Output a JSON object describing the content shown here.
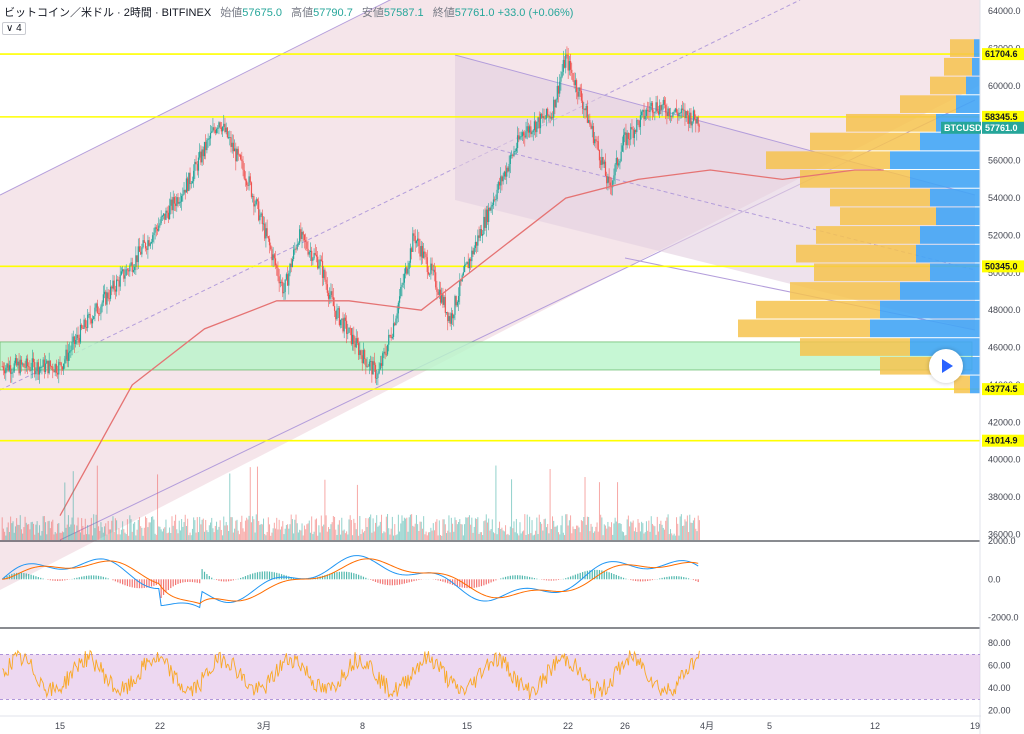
{
  "header": {
    "symbol_line": "ビットコイン／米ドル · 2時間 · BITFINEX",
    "open_label": "始値",
    "open": "57675.0",
    "high_label": "高値",
    "high": "57790.7",
    "low_label": "安値",
    "low": "57587.1",
    "close_label": "終値",
    "close": "57761.0",
    "change": "+33.0 (+0.06%)"
  },
  "indicator_toggle": "∨ 4",
  "colors": {
    "up": "#26a69a",
    "down": "#ef5350",
    "level": "#ffff00",
    "channel": "#b39ddb",
    "zone": "#b9f6ca",
    "ma": "#e57373",
    "vp_up": "#42a5f5",
    "vp_down": "#f6c34e",
    "rsi": "#f9a825",
    "rsi_band": "#e1bee7"
  },
  "chart_data": [
    {
      "type": "candlestick",
      "title": "",
      "x_ticks": [
        "15",
        "22",
        "3月",
        "8",
        "15",
        "22",
        "26",
        "4月",
        "5",
        "12",
        "19"
      ],
      "y_ticks": [
        36000,
        38000,
        40000,
        42000,
        44000,
        46000,
        48000,
        50000,
        52000,
        54000,
        56000,
        58000,
        60000,
        62000,
        64000
      ],
      "y_tick_labels": [
        "36000.0",
        "38000.0",
        "40000.0",
        "42000.0",
        "44000.0",
        "46000.0",
        "48000.0",
        "50000.0",
        "52000.0",
        "54000.0",
        "56000.0",
        "58000.0",
        "60000.0",
        "62000.0",
        "64000.0"
      ],
      "ylim": [
        35700,
        64600
      ],
      "price_levels": [
        61704.6,
        58345.5,
        50345.0,
        43774.5,
        41014.9
      ],
      "price_level_labels": [
        "61704.6",
        "58345.5",
        "50345.0",
        "43774.5",
        "41014.9"
      ],
      "symbol_tag": "BTCUSD",
      "last_price": "57761.0",
      "support_zone": [
        44800,
        46300
      ],
      "close_path_x_ticks": [
        0,
        4,
        9,
        11,
        14,
        17,
        20,
        23,
        26,
        28,
        30,
        33
      ],
      "close_path": [
        [
          0,
          45000
        ],
        [
          2,
          47500
        ],
        [
          5,
          50500
        ],
        [
          9,
          55000
        ],
        [
          11,
          58200
        ],
        [
          13,
          55000
        ],
        [
          15.5,
          49000
        ],
        [
          16.5,
          52000
        ],
        [
          18,
          50500
        ],
        [
          19,
          48000
        ],
        [
          21,
          45500
        ],
        [
          22,
          44500
        ],
        [
          23,
          47000
        ],
        [
          24.5,
          52000
        ],
        [
          26,
          49500
        ],
        [
          27,
          47500
        ],
        [
          28,
          50000
        ],
        [
          30,
          54000
        ],
        [
          32,
          57500
        ],
        [
          34,
          58500
        ],
        [
          35,
          61500
        ],
        [
          36,
          59500
        ],
        [
          37.5,
          56000
        ],
        [
          38,
          54500
        ],
        [
          39,
          57000
        ],
        [
          41,
          59000
        ],
        [
          43,
          58500
        ],
        [
          45,
          58000
        ],
        [
          46,
          55000
        ],
        [
          47,
          56500
        ],
        [
          48,
          53500
        ],
        [
          49,
          54500
        ],
        [
          50,
          51500
        ],
        [
          51.5,
          50500
        ],
        [
          52.5,
          53500
        ],
        [
          54,
          55000
        ],
        [
          55.5,
          55500
        ],
        [
          56.5,
          58300
        ],
        [
          57.5,
          57761
        ]
      ],
      "series": [
        {
          "name": "",
          "type": "ma",
          "values": [
            [
              0,
              37000
            ],
            [
              5,
              44000
            ],
            [
              10,
              47000
            ],
            [
              15,
              48500
            ],
            [
              20,
              48500
            ],
            [
              25,
              48000
            ],
            [
              30,
              51000
            ],
            [
              35,
              54000
            ],
            [
              40,
              55000
            ],
            [
              45,
              55500
            ],
            [
              50,
              55000
            ],
            [
              55,
              55500
            ],
            [
              57,
              55500
            ]
          ]
        }
      ],
      "volume_profile": [
        {
          "price": 62000,
          "up": 0.12,
          "down": 0.03
        },
        {
          "price": 61000,
          "up": 0.14,
          "down": 0.04
        },
        {
          "price": 60000,
          "up": 0.18,
          "down": 0.07
        },
        {
          "price": 59000,
          "up": 0.28,
          "down": 0.12
        },
        {
          "price": 58000,
          "up": 0.45,
          "down": 0.22
        },
        {
          "price": 57000,
          "up": 0.55,
          "down": 0.3
        },
        {
          "price": 56000,
          "up": 0.62,
          "down": 0.45
        },
        {
          "price": 55000,
          "up": 0.55,
          "down": 0.35
        },
        {
          "price": 54000,
          "up": 0.5,
          "down": 0.25
        },
        {
          "price": 53000,
          "up": 0.48,
          "down": 0.22
        },
        {
          "price": 52000,
          "up": 0.52,
          "down": 0.3
        },
        {
          "price": 51000,
          "up": 0.6,
          "down": 0.32
        },
        {
          "price": 50000,
          "up": 0.58,
          "down": 0.25
        },
        {
          "price": 49000,
          "up": 0.55,
          "down": 0.4
        },
        {
          "price": 48000,
          "up": 0.62,
          "down": 0.5
        },
        {
          "price": 47000,
          "up": 0.66,
          "down": 0.55
        },
        {
          "price": 46000,
          "up": 0.55,
          "down": 0.35
        },
        {
          "price": 45000,
          "up": 0.3,
          "down": 0.2
        },
        {
          "price": 44000,
          "up": 0.08,
          "down": 0.05
        }
      ]
    },
    {
      "type": "line",
      "title": "",
      "y_ticks": [
        -2000,
        0,
        2000
      ],
      "y_tick_labels": [
        "-2000.0",
        "0.0",
        "2000.0"
      ],
      "ylim": [
        -2400,
        1800
      ]
    },
    {
      "type": "line",
      "title": "",
      "y_ticks": [
        20,
        40,
        60,
        80
      ],
      "y_tick_labels": [
        "20.00",
        "40.00",
        "60.00",
        "80.00"
      ],
      "ylim": [
        17,
        90
      ],
      "band": [
        30,
        70
      ]
    }
  ]
}
